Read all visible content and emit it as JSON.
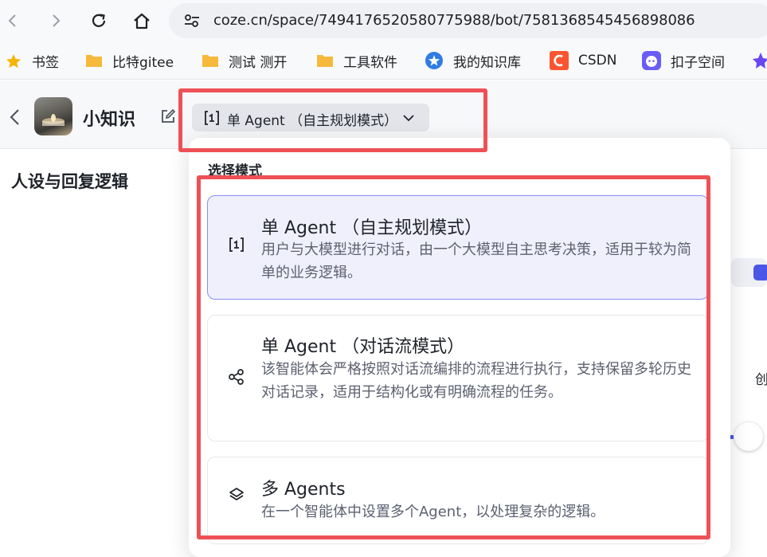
{
  "browser": {
    "url": "coze.cn/space/7494176520580775988/bot/7581368545456898086",
    "bookmarks": [
      {
        "label": "书签",
        "icon": "star-icon"
      },
      {
        "label": "比特gitee",
        "icon": "folder-icon"
      },
      {
        "label": "测试 测开",
        "icon": "folder-icon"
      },
      {
        "label": "工具软件",
        "icon": "folder-icon"
      },
      {
        "label": "我的知识库",
        "icon": "knowledge-base-icon"
      },
      {
        "label": "CSDN",
        "icon": "csdn-icon"
      },
      {
        "label": "扣子空间",
        "icon": "coze-space-icon"
      }
    ]
  },
  "header": {
    "bot_name": "小知识",
    "mode_button_label": "单 Agent （自主规划模式）"
  },
  "left_panel": {
    "section_title": "人设与回复逻辑"
  },
  "right_panel": {
    "partial_text": "创"
  },
  "dropdown": {
    "header": "选择模式",
    "options": [
      {
        "title": "单 Agent （自主规划模式）",
        "description": "用户与大模型进行对话，由一个大模型自主思考决策，适用于较为简单的业务逻辑。",
        "icon": "agent-bracket-icon",
        "selected": true
      },
      {
        "title": "单 Agent （对话流模式）",
        "description": "该智能体会严格按照对话流编排的流程进行执行，支持保留多轮历史对话记录，适用于结构化或有明确流程的任务。",
        "icon": "workflow-nodes-icon",
        "selected": false
      },
      {
        "title": "多 Agents",
        "description": "在一个智能体中设置多个Agent，以处理复杂的逻辑。",
        "icon": "layers-icon",
        "selected": false
      }
    ]
  },
  "colors": {
    "annotation_red": "#ee5055",
    "selected_bg": "#f0f0fd",
    "selected_border": "#8b8df5",
    "accent": "#4a56e6"
  }
}
